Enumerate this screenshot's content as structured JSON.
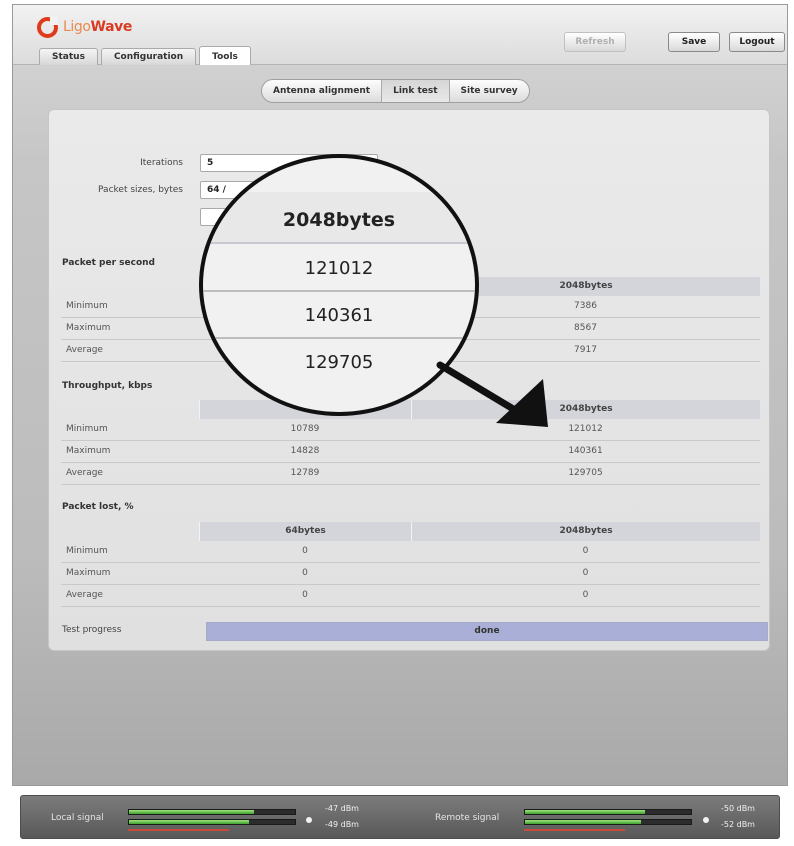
{
  "brand": {
    "part1": "Ligo",
    "part2": "Wave"
  },
  "tabs": [
    {
      "label": "Status",
      "active": false
    },
    {
      "label": "Configuration",
      "active": false
    },
    {
      "label": "Tools",
      "active": true
    }
  ],
  "header_buttons": {
    "refresh": "Refresh",
    "save": "Save",
    "logout": "Logout"
  },
  "subtabs": [
    {
      "label": "Antenna alignment",
      "active": false
    },
    {
      "label": "Link test",
      "active": true
    },
    {
      "label": "Site survey",
      "active": false
    }
  ],
  "form": {
    "iterations_label": "Iterations",
    "iterations_value": "5",
    "packet_sizes_label": "Packet sizes, bytes",
    "packet_sizes_value": "64 /"
  },
  "pps": {
    "title": "Packet per second",
    "col2": "2048bytes",
    "rows": [
      {
        "label": "Minimum",
        "v1": "",
        "v2": "7386"
      },
      {
        "label": "Maximum",
        "v1": "",
        "v2": "8567"
      },
      {
        "label": "Average",
        "v1": "",
        "v2": "7917"
      }
    ]
  },
  "throughput": {
    "title": "Throughput, kbps",
    "col1": "",
    "col2": "2048bytes",
    "rows": [
      {
        "label": "Minimum",
        "v1": "10789",
        "v2": "121012"
      },
      {
        "label": "Maximum",
        "v1": "14828",
        "v2": "140361"
      },
      {
        "label": "Average",
        "v1": "12789",
        "v2": "129705"
      }
    ]
  },
  "packet_lost": {
    "title": "Packet lost, %",
    "col1": "64bytes",
    "col2": "2048bytes",
    "rows": [
      {
        "label": "Minimum",
        "v1": "0",
        "v2": "0"
      },
      {
        "label": "Maximum",
        "v1": "0",
        "v2": "0"
      },
      {
        "label": "Average",
        "v1": "0",
        "v2": "0"
      }
    ]
  },
  "progress": {
    "label": "Test progress",
    "status": "done",
    "fraction": 1.0
  },
  "magnifier": {
    "header": "2048bytes",
    "v1": "121012",
    "v2": "140361",
    "v3": "129705"
  },
  "signal": {
    "local_label": "Local signal",
    "local_dbm1": "-47 dBm",
    "local_dbm2": "-49 dBm",
    "local_level1": 0.75,
    "local_level2": 0.72,
    "remote_label": "Remote signal",
    "remote_dbm1": "-50 dBm",
    "remote_dbm2": "-52 dBm",
    "remote_level1": 0.72,
    "remote_level2": 0.7
  },
  "colors": {
    "accent_red": "#d93c22",
    "progress": "#a9afd6",
    "signal_green": "#5bbf42"
  }
}
